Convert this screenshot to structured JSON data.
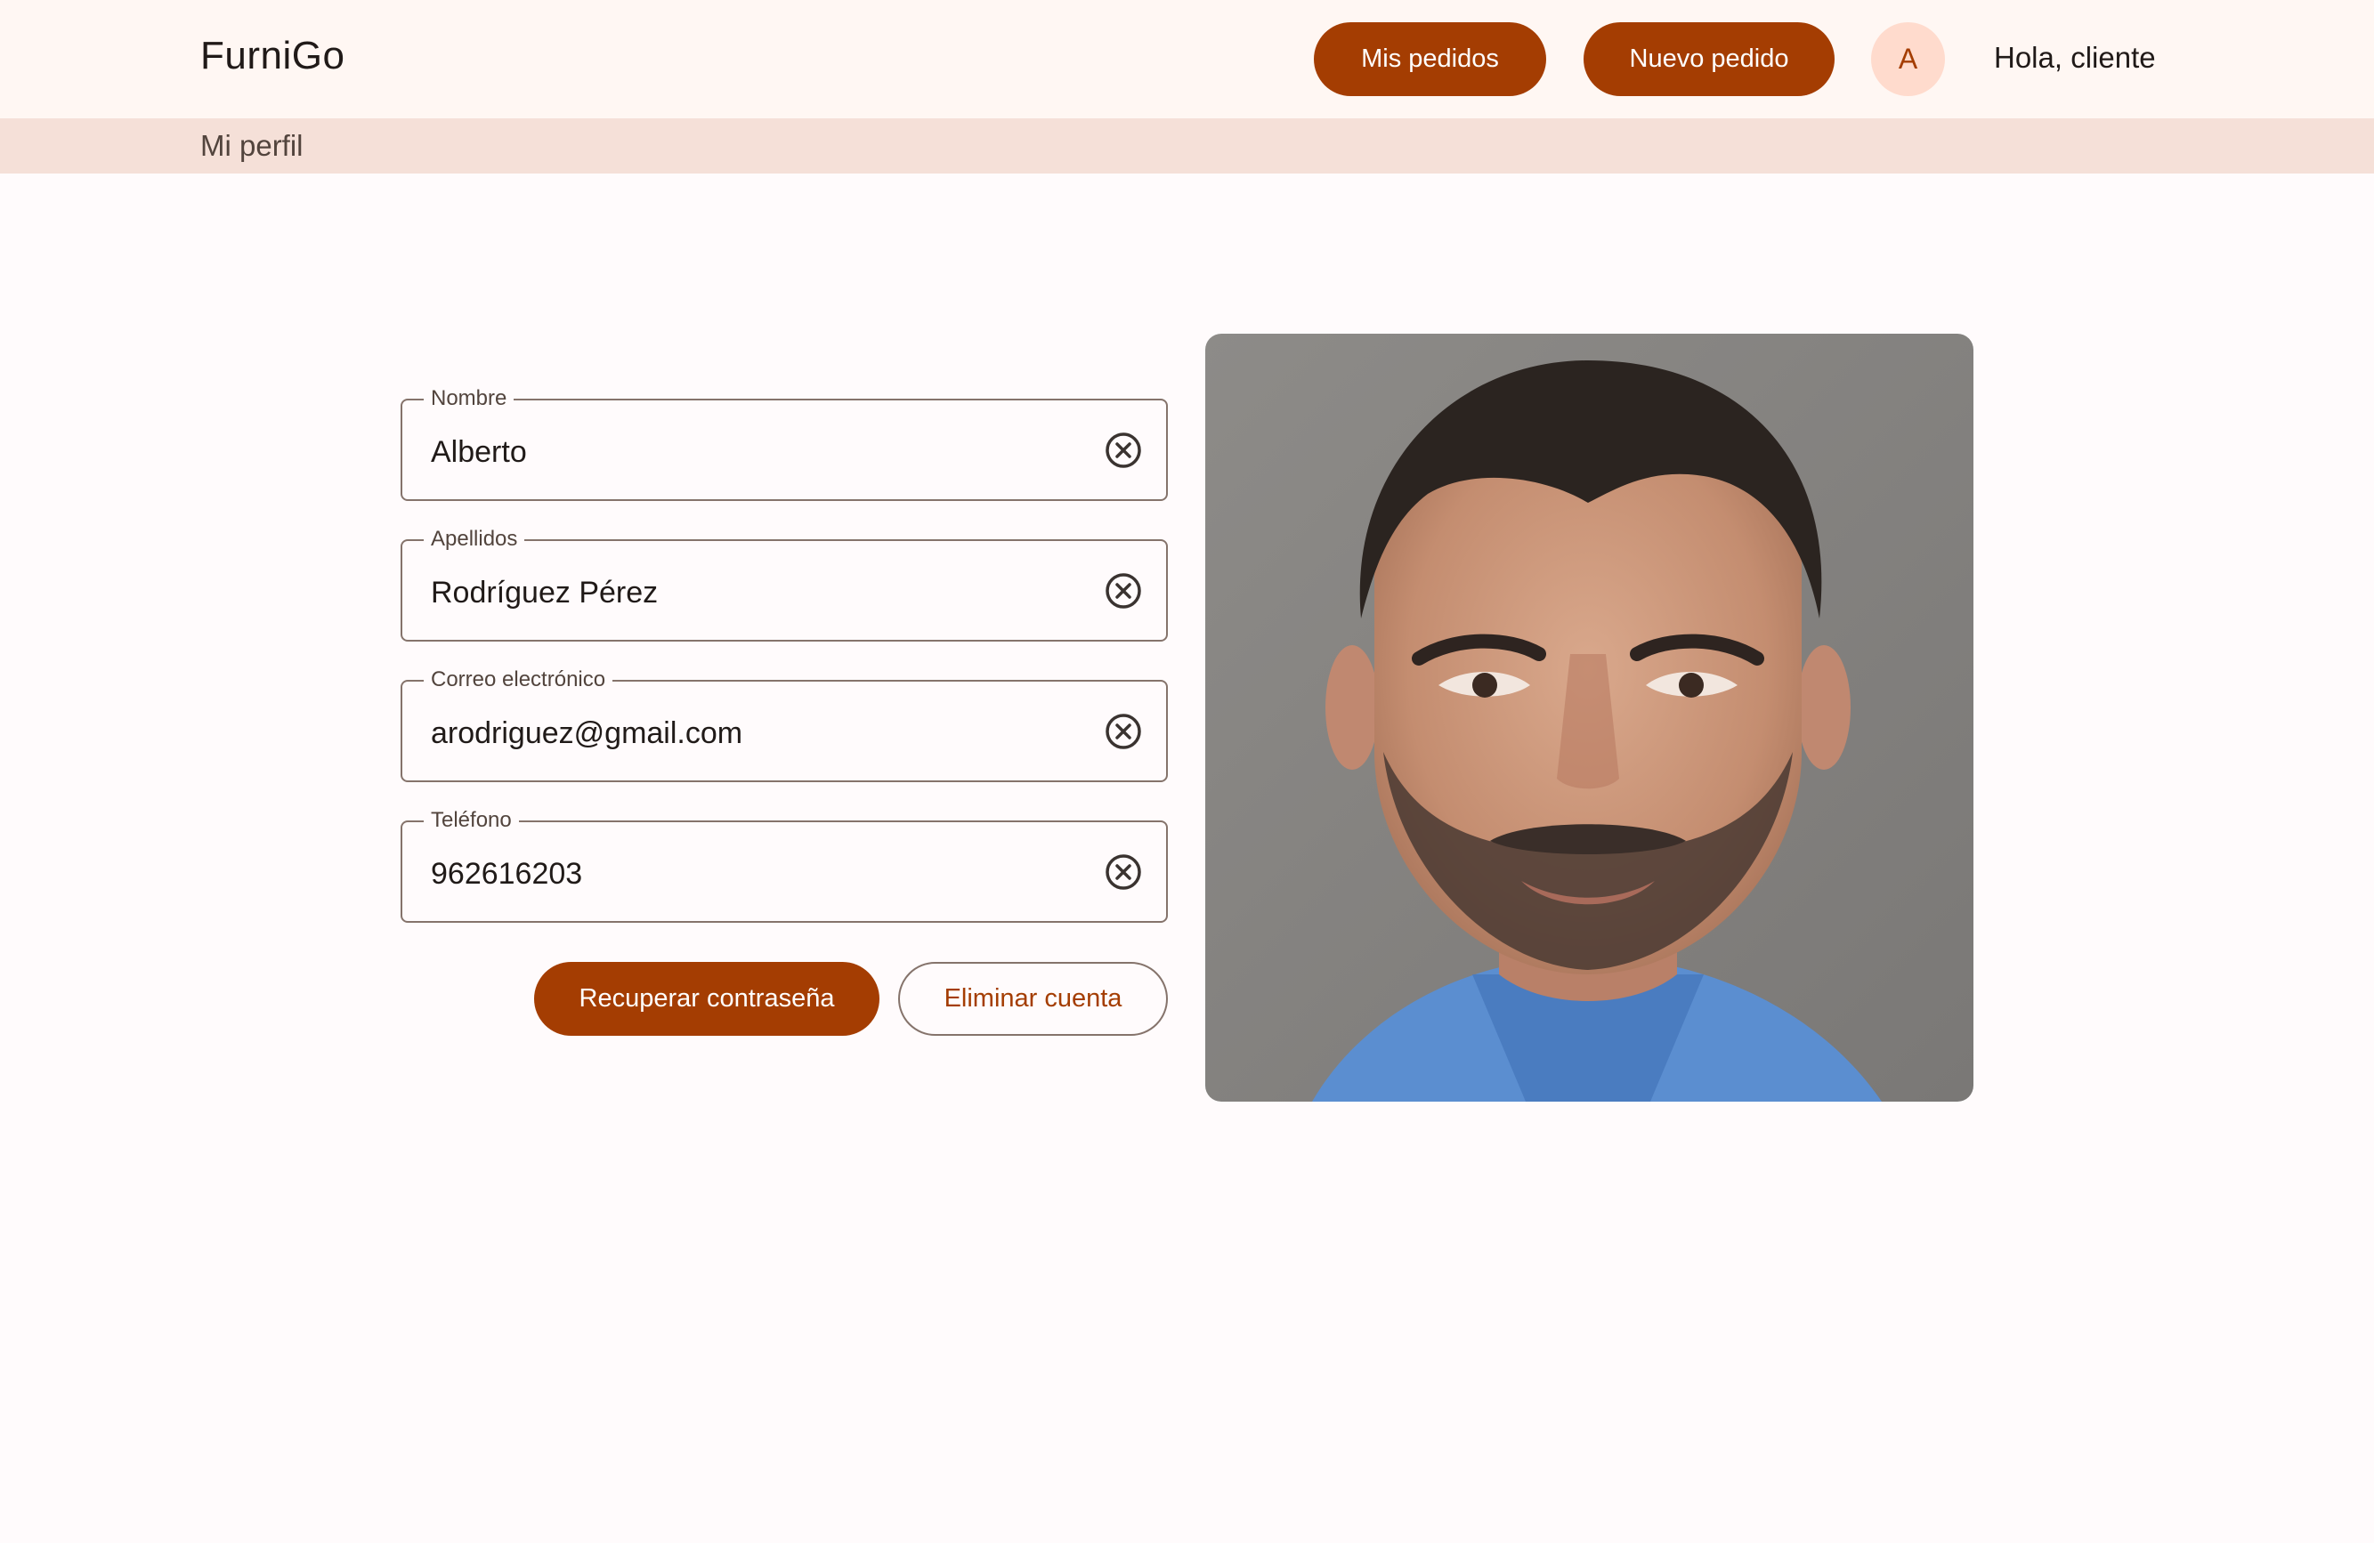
{
  "app": {
    "brand": "FurniGo",
    "greeting": "Hola, cliente"
  },
  "nav": {
    "orders_label": "Mis pedidos",
    "new_order_label": "Nuevo pedido",
    "avatar_initial": "A"
  },
  "page": {
    "title": "Mi perfil"
  },
  "form": {
    "fields": [
      {
        "label": "Nombre",
        "value": "Alberto"
      },
      {
        "label": "Apellidos",
        "value": "Rodríguez Pérez"
      },
      {
        "label": "Correo electrónico",
        "value": "arodriguez@gmail.com"
      },
      {
        "label": "Teléfono",
        "value": "962616203"
      }
    ],
    "clear_icon": "close-circle-icon",
    "recover_password_label": "Recuperar contraseña",
    "delete_account_label": "Eliminar cuenta"
  },
  "profile_photo": {
    "subject": "profile-photo"
  },
  "colors": {
    "primary": "#a43d02",
    "avatar_bg": "#ffdbcd",
    "topbar_bg": "#fff7f3",
    "subbar_bg": "#f5e0d8",
    "outline": "#85736b",
    "background": "#fffbfc"
  }
}
